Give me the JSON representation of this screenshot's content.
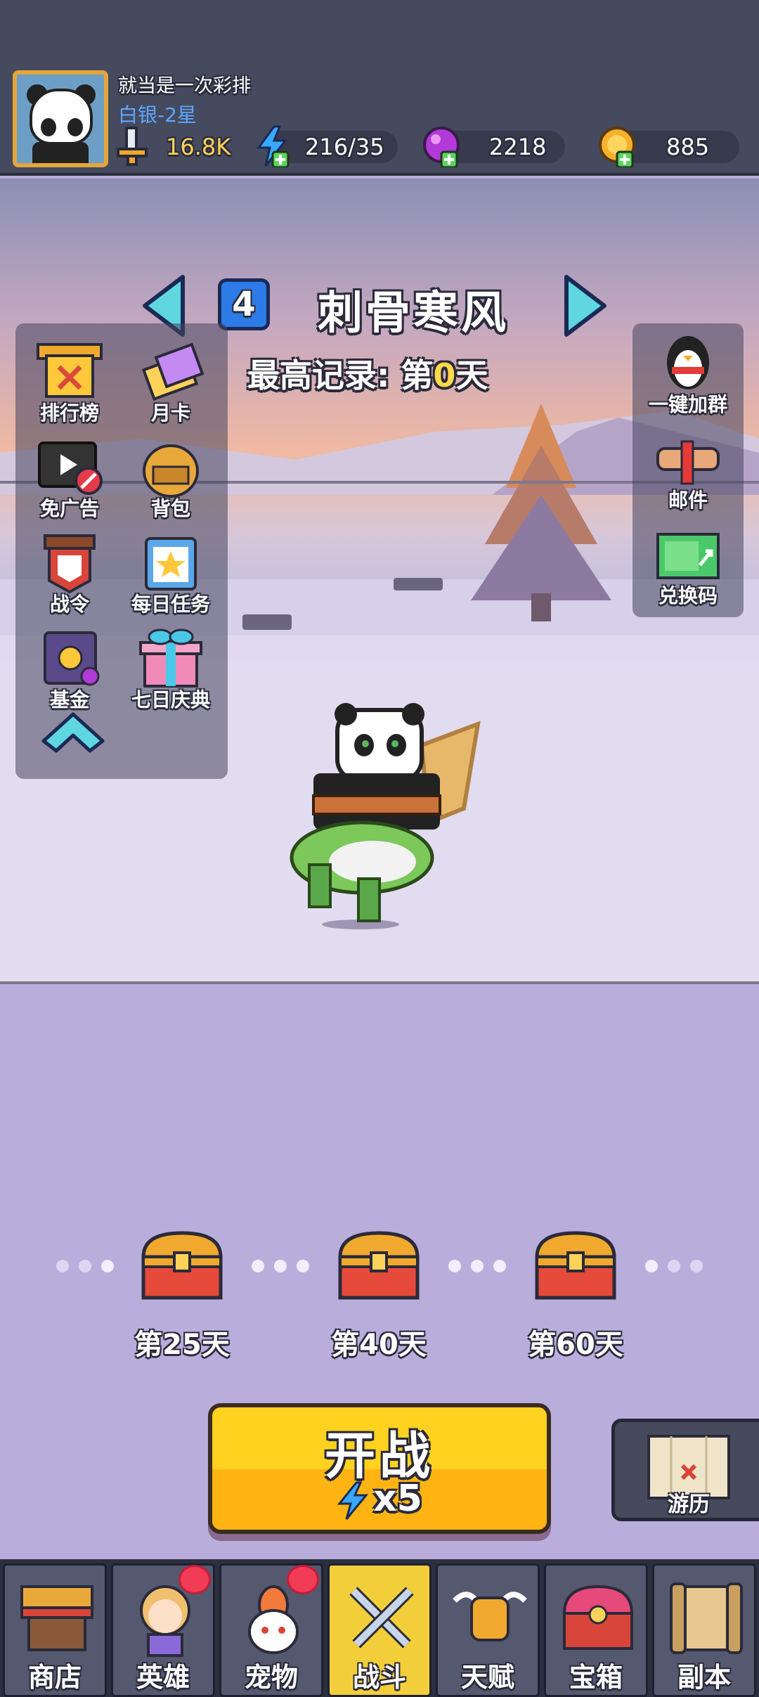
{
  "player": {
    "name": "就当是一次彩排",
    "rank": "白银-2星",
    "power": "16.8K",
    "energy": "216/35",
    "gems": "2218",
    "coins": "885"
  },
  "stage": {
    "number": "4",
    "name": "刺骨寒风",
    "best_prefix": "最高记录: 第",
    "best_day": "0",
    "best_suffix": "天"
  },
  "left_menu": {
    "leaderboard": "排行榜",
    "monthly_card": "月卡",
    "ad_free": "免广告",
    "backpack": "背包",
    "battle_pass": "战令",
    "daily_tasks": "每日任务",
    "fund": "基金",
    "seven_day": "七日庆典"
  },
  "right_menu": {
    "join_group": "一键加群",
    "mail": "邮件",
    "redeem_code": "兑换码"
  },
  "rewards": [
    {
      "label": "第25天"
    },
    {
      "label": "第40天"
    },
    {
      "label": "第60天"
    }
  ],
  "start": {
    "label": "开战",
    "cost": "x5"
  },
  "journey": {
    "label": "游历"
  },
  "nav": [
    {
      "label": "商店"
    },
    {
      "label": "英雄"
    },
    {
      "label": "宠物"
    },
    {
      "label": "战斗"
    },
    {
      "label": "天赋"
    },
    {
      "label": "宝箱"
    },
    {
      "label": "副本"
    }
  ],
  "colors": {
    "header_bg": "#454a5e",
    "accent_gold": "#ffd21f",
    "rank_blue": "#5ca8ff",
    "notification_red": "#f23c55"
  }
}
